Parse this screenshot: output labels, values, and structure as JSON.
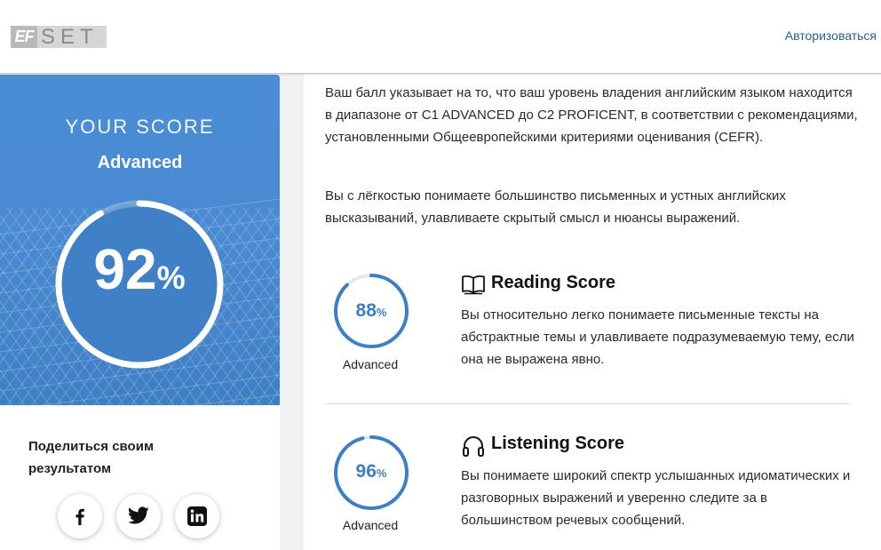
{
  "header": {
    "logo_ef": "EF",
    "logo_set": "SET",
    "login_label": "Авторизоваться"
  },
  "score_panel": {
    "heading": "YOUR SCORE",
    "level": "Advanced",
    "percent": "92",
    "percent_value": 0.92,
    "percent_sign": "%",
    "accent_color": "#4a8ad2"
  },
  "share": {
    "title": "Поделиться своим результатом",
    "buttons": [
      {
        "name": "facebook",
        "icon": "facebook-icon"
      },
      {
        "name": "twitter",
        "icon": "twitter-icon"
      },
      {
        "name": "linkedin",
        "icon": "linkedin-icon"
      }
    ]
  },
  "content": {
    "paragraph1": "Ваш балл указывает на то, что ваш уровень владения английским языком находится в диапазоне от C1 ADVANCED до C2 PROFICENT, в соответствии с рекомендациями, установленными Общеевропейскими критериями оценивания (CEFR).",
    "paragraph2": "Вы с лёгкостью понимаете большинство письменных и устных английских высказываний, улавливаете скрытый смысл и нюансы выражений.",
    "sections": [
      {
        "icon": "book-icon",
        "title": "Reading Score",
        "percent": "88",
        "percent_value": 0.88,
        "percent_sign": "%",
        "level": "Advanced",
        "description": "Вы относительно легко понимаете письменные тексты на абстрактные темы и улавливаете подразумеваемую тему, если она не выражена явно."
      },
      {
        "icon": "headphones-icon",
        "title": "Listening Score",
        "percent": "96",
        "percent_value": 0.96,
        "percent_sign": "%",
        "level": "Advanced",
        "description": "Вы понимаете широкий спектр услышанных идиоматических и разговорных выражений и уверенно следите за в большинством речевых сообщений."
      }
    ]
  }
}
